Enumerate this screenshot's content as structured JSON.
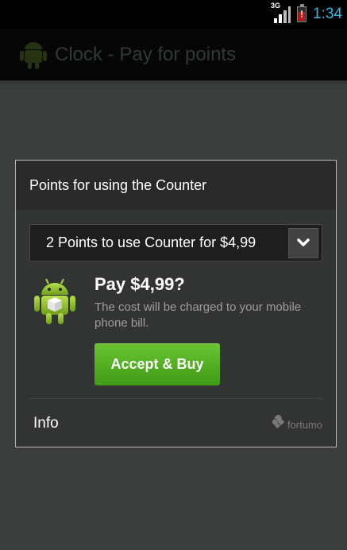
{
  "status_bar": {
    "network_type": "3G",
    "time": "1:34",
    "icons": [
      "signal-icon",
      "battery-alert-icon"
    ]
  },
  "action_bar": {
    "title": "Clock - Pay for points",
    "icon": "android-app-icon"
  },
  "dialog": {
    "header": "Points for using the Counter",
    "dropdown": {
      "selected": "2 Points to use Counter for $4,99",
      "icon": "chevron-down-icon"
    },
    "pay_title": "Pay $4,99?",
    "pay_description": "The cost will be charged to your mobile phone bill.",
    "buy_button": "Accept & Buy",
    "info_label": "Info",
    "provider": "fortumo"
  },
  "colors": {
    "accent_clock": "#33b5e5",
    "buy_button": "#4fae20",
    "battery_alert": "#c91515",
    "dialog_background": "#323433"
  }
}
